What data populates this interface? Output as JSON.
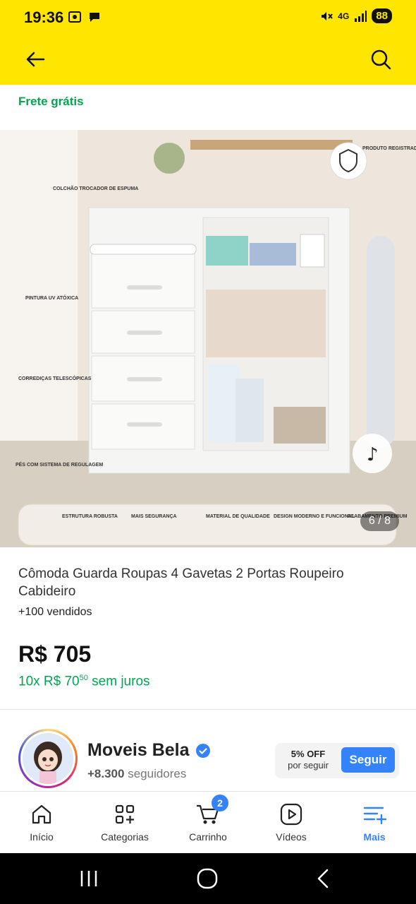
{
  "status_bar": {
    "time": "19:36",
    "battery": "88",
    "network": "4G"
  },
  "header": {
    "back_icon": "arrow-left-icon",
    "search_icon": "search-icon",
    "bg_color": "#FFE600"
  },
  "shipping": {
    "label": "Frete grátis",
    "color": "#00A650"
  },
  "gallery": {
    "pager": "6 / 8",
    "image_labels": {
      "registered": "PRODUTO REGISTRADO®",
      "changing_pad": "COLCHÃO TROCADOR DE ESPUMA",
      "paint": "PINTURA UV ATÓXICA",
      "slides": "CORREDIÇAS TELESCÓPICAS",
      "feet": "PÉS COM SISTEMA DE REGULAGEM",
      "strip": [
        "ESTRUTURA ROBUSTA",
        "MAIS SEGURANÇA",
        "MATERIAL DE QUALIDADE",
        "DESIGN MODERNO E FUNCIONAL",
        "ACABAMENTO PREMIUM"
      ]
    }
  },
  "product": {
    "title": "Cômoda Guarda Roupas 4 Gavetas 2 Portas Roupeiro Cabideiro",
    "sold": "+100 vendidos",
    "price": "R$ 705",
    "installments_prefix": "10x R$ 70",
    "installments_cents": "50",
    "installments_suffix": " sem juros"
  },
  "seller": {
    "name": "Moveis Bela",
    "followers_count": "+8.300",
    "followers_label": " seguidores",
    "follow_discount": "5% OFF",
    "follow_discount_sub": "por seguir",
    "follow_button": "Seguir",
    "accent": "#3483FA"
  },
  "bottom_nav": {
    "items": [
      {
        "label": "Início",
        "icon": "home-icon"
      },
      {
        "label": "Categorias",
        "icon": "categories-icon"
      },
      {
        "label": "Carrinho",
        "icon": "cart-icon",
        "badge": "2"
      },
      {
        "label": "Vídeos",
        "icon": "video-icon"
      },
      {
        "label": "Mais",
        "icon": "more-menu-icon",
        "active": true
      }
    ]
  }
}
